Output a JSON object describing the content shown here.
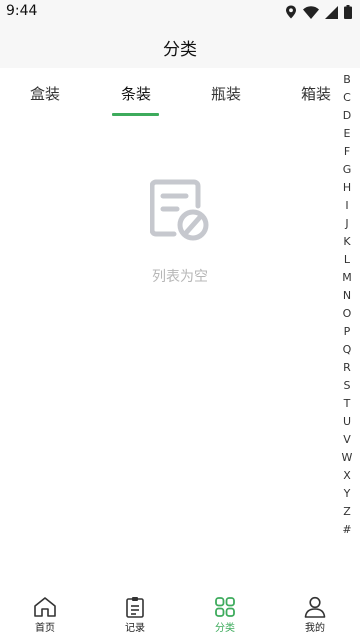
{
  "status_bar": {
    "time": "9:44",
    "icons": [
      "location-icon",
      "wifi-icon",
      "signal-icon",
      "battery-icon"
    ]
  },
  "header": {
    "title": "分类"
  },
  "tabs": [
    {
      "label": "盒装",
      "active": false
    },
    {
      "label": "条装",
      "active": true
    },
    {
      "label": "瓶装",
      "active": false
    },
    {
      "label": "箱装",
      "active": false
    }
  ],
  "index_letters": [
    "B",
    "C",
    "D",
    "E",
    "F",
    "G",
    "H",
    "I",
    "J",
    "K",
    "L",
    "M",
    "N",
    "O",
    "P",
    "Q",
    "R",
    "S",
    "T",
    "U",
    "V",
    "W",
    "X",
    "Y",
    "Z",
    "#"
  ],
  "empty_state": {
    "icon": "empty-list-icon",
    "text": "列表为空"
  },
  "bottom_nav": [
    {
      "label": "首页",
      "icon": "home-icon",
      "active": false
    },
    {
      "label": "记录",
      "icon": "clipboard-icon",
      "active": false
    },
    {
      "label": "分类",
      "icon": "grid-icon",
      "active": true
    },
    {
      "label": "我的",
      "icon": "user-icon",
      "active": false
    }
  ],
  "colors": {
    "accent": "#3dab5c",
    "header_bg": "#f7f7f7",
    "muted_text": "#b7b7b7",
    "icon_gray": "#c6c8ce"
  }
}
